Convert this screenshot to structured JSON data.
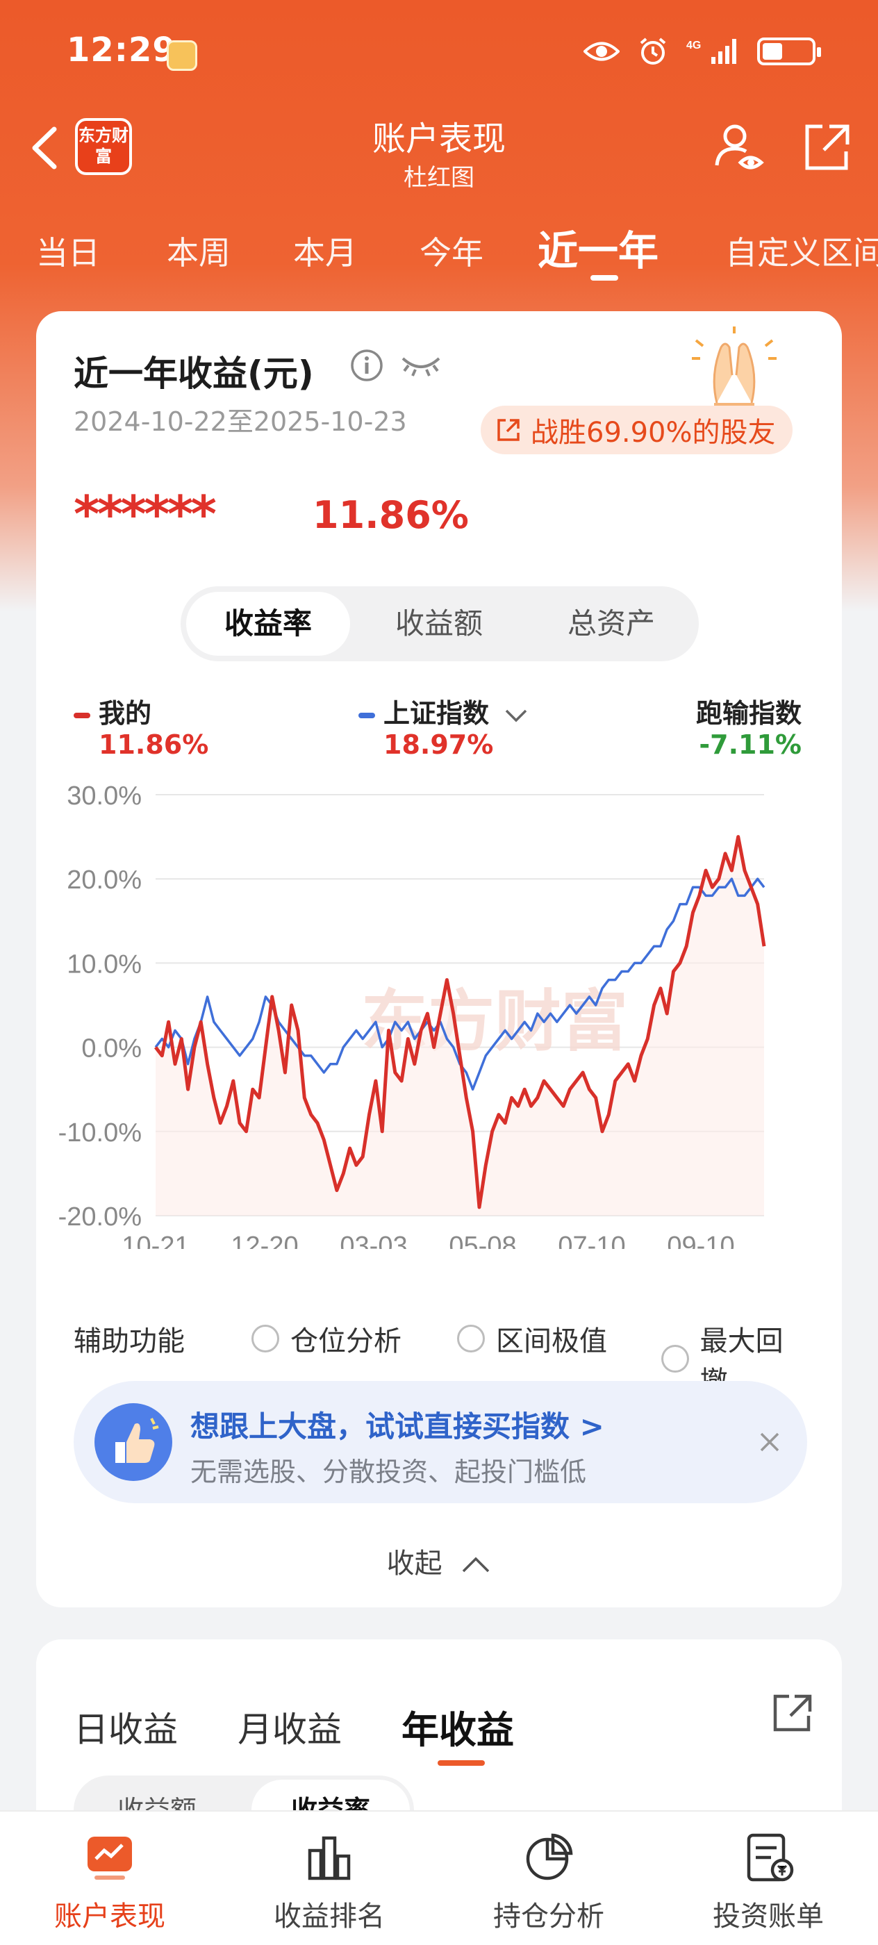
{
  "status_bar": {
    "time": "12:29",
    "network": "4G"
  },
  "header": {
    "logo_text": "东方财富",
    "title": "账户表现",
    "subtitle": "杜红图"
  },
  "period_tabs": [
    "当日",
    "本周",
    "本月",
    "今年",
    "近一年",
    "自定义区间"
  ],
  "active_period": "近一年",
  "summary": {
    "title": "近一年收益(元)",
    "date_range": "2024-10-22至2025-10-23",
    "beat_badge": "战胜69.90%的股友",
    "masked_amount": "******",
    "return_rate": "11.86%"
  },
  "segment": {
    "options": [
      "收益率",
      "收益额",
      "总资产"
    ],
    "active": "收益率"
  },
  "legend": {
    "mine_label": "我的",
    "mine_value": "11.86%",
    "index_label": "上证指数",
    "index_value": "18.97%",
    "diff_label": "跑输指数",
    "diff_value": "-7.11%"
  },
  "colors": {
    "brand": "#ec5a2a",
    "mine": "#d8302a",
    "index": "#3f6fd9",
    "positive": "#e0322a",
    "negative": "#2f9b3a"
  },
  "chart_data": {
    "type": "line",
    "x_tick_labels": [
      "10-21",
      "12-20",
      "03-03",
      "05-08",
      "07-10",
      "09-10"
    ],
    "y_tick_labels": [
      "30.0%",
      "20.0%",
      "10.0%",
      "0.0%",
      "-10.0%",
      "-20.0%"
    ],
    "ylim": [
      -20,
      30
    ],
    "grid": true,
    "watermark": "东方财富",
    "series": [
      {
        "name": "我的",
        "color": "#d8302a",
        "values": [
          0,
          -1,
          3,
          -2,
          1,
          -5,
          0,
          3,
          -2,
          -6,
          -9,
          -7,
          -4,
          -9,
          -10,
          -5,
          -6,
          0,
          6,
          2,
          -3,
          5,
          2,
          -6,
          -8,
          -9,
          -11,
          -14,
          -17,
          -15,
          -12,
          -14,
          -13,
          -8,
          -4,
          -10,
          2,
          -3,
          -4,
          1,
          -2,
          2,
          4,
          0,
          4,
          8,
          4,
          -1,
          -6,
          -10,
          -19,
          -14,
          -10,
          -8,
          -9,
          -6,
          -7,
          -5,
          -7,
          -6,
          -4,
          -5,
          -6,
          -7,
          -5,
          -4,
          -3,
          -5,
          -6,
          -10,
          -8,
          -4,
          -3,
          -2,
          -4,
          -1,
          1,
          5,
          7,
          4,
          9,
          10,
          12,
          16,
          18,
          21,
          19,
          20,
          23,
          21,
          25,
          21,
          19,
          17,
          12
        ]
      },
      {
        "name": "上证指数",
        "color": "#3f6fd9",
        "values": [
          0,
          1,
          0,
          2,
          1,
          -2,
          1,
          3,
          6,
          3,
          2,
          1,
          0,
          -1,
          0,
          1,
          3,
          6,
          5,
          3,
          2,
          1,
          0,
          -1,
          -1,
          -2,
          -3,
          -2,
          -2,
          0,
          1,
          2,
          1,
          2,
          3,
          0,
          1,
          3,
          2,
          3,
          1,
          2,
          3,
          2,
          3,
          1,
          0,
          -2,
          -3,
          -5,
          -3,
          -1,
          0,
          1,
          2,
          1,
          2,
          3,
          2,
          4,
          3,
          4,
          3,
          4,
          5,
          4,
          5,
          6,
          5,
          7,
          8,
          8,
          9,
          9,
          10,
          10,
          11,
          12,
          12,
          14,
          15,
          17,
          17,
          19,
          19,
          18,
          18,
          19,
          19,
          20,
          18,
          18,
          19,
          20,
          19
        ]
      }
    ]
  },
  "aux": {
    "label": "辅助功能",
    "options": [
      "仓位分析",
      "区间极值",
      "最大回撤"
    ]
  },
  "promo": {
    "title": "想跟上大盘，试试直接买指数 >",
    "subtitle": "无需选股、分散投资、起投门槛低"
  },
  "collapse_label": "收起",
  "returns_tabs": {
    "options": [
      "日收益",
      "月收益",
      "年收益"
    ],
    "active": "年收益"
  },
  "returns_segment": {
    "options": [
      "收益额",
      "收益率"
    ],
    "active": "收益率"
  },
  "bottom_nav": [
    {
      "label": "账户表现",
      "icon": "chart-screen-icon",
      "active": true
    },
    {
      "label": "收益排名",
      "icon": "bar-chart-icon",
      "active": false
    },
    {
      "label": "持仓分析",
      "icon": "pie-chart-icon",
      "active": false
    },
    {
      "label": "投资账单",
      "icon": "bill-icon",
      "active": false
    }
  ]
}
